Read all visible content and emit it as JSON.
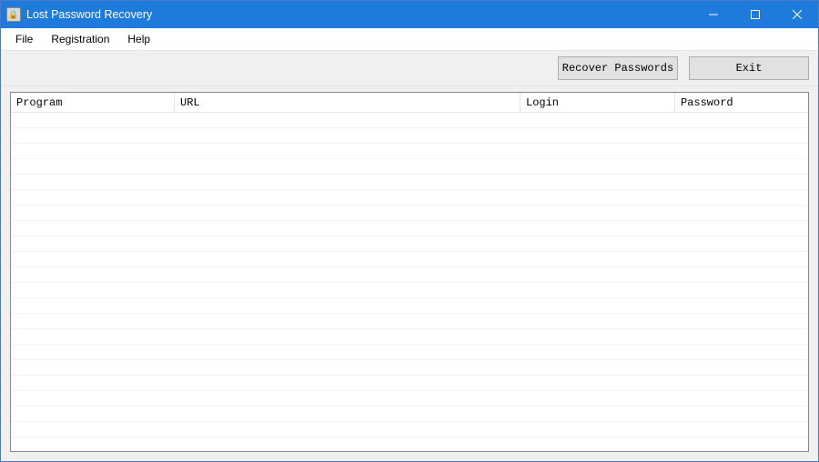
{
  "window": {
    "title": "Lost Password Recovery"
  },
  "menu": {
    "items": [
      {
        "label": "File"
      },
      {
        "label": "Registration"
      },
      {
        "label": "Help"
      }
    ]
  },
  "toolbar": {
    "recover_label": "Recover Passwords",
    "exit_label": "Exit"
  },
  "table": {
    "columns": {
      "program": "Program",
      "url": "URL",
      "login": "Login",
      "password": "Password"
    },
    "rows": []
  }
}
